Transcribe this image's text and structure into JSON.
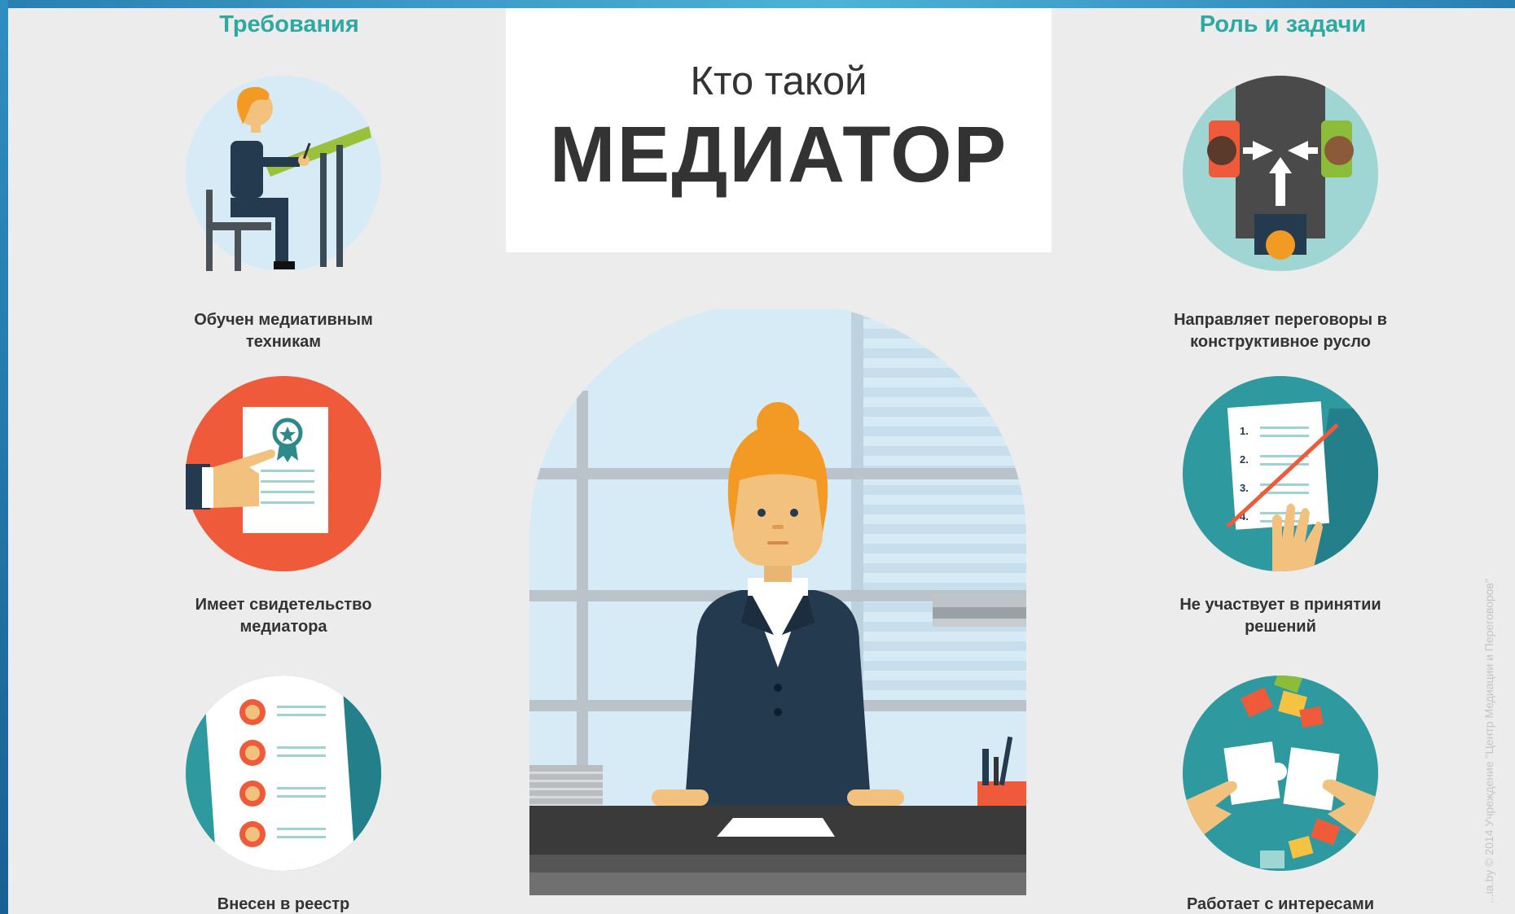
{
  "header": {
    "left_column_title": "Требования",
    "right_column_title": "Роль и задачи",
    "title_line1": "Кто такой",
    "title_line2": "МЕДИАТОР"
  },
  "requirements": [
    {
      "label": "Обучен медиативным техникам",
      "icon": "student-at-desk-icon"
    },
    {
      "label": "Имеет свидетельство медиатора",
      "icon": "certificate-icon"
    },
    {
      "label": "Внесен в реестр",
      "icon": "registry-list-icon"
    }
  ],
  "roles": [
    {
      "label": "Направляет переговоры в конструктивное русло",
      "icon": "negotiation-table-icon"
    },
    {
      "label": "Не участвует в принятии решений",
      "icon": "crossed-document-icon"
    },
    {
      "label": "Работает с интересами",
      "icon": "puzzle-pieces-icon"
    }
  ],
  "watermark": "...ia.by © 2014 Учреждение \"Центр Медиации и Переговоров\"",
  "colors": {
    "teal_title": "#2ba9a2",
    "text_dark": "#333333",
    "background": "#ececec",
    "orange_red": "#ef5b3a",
    "teal_circle": "#2e9aa0",
    "light_blue": "#d6ebf5"
  }
}
